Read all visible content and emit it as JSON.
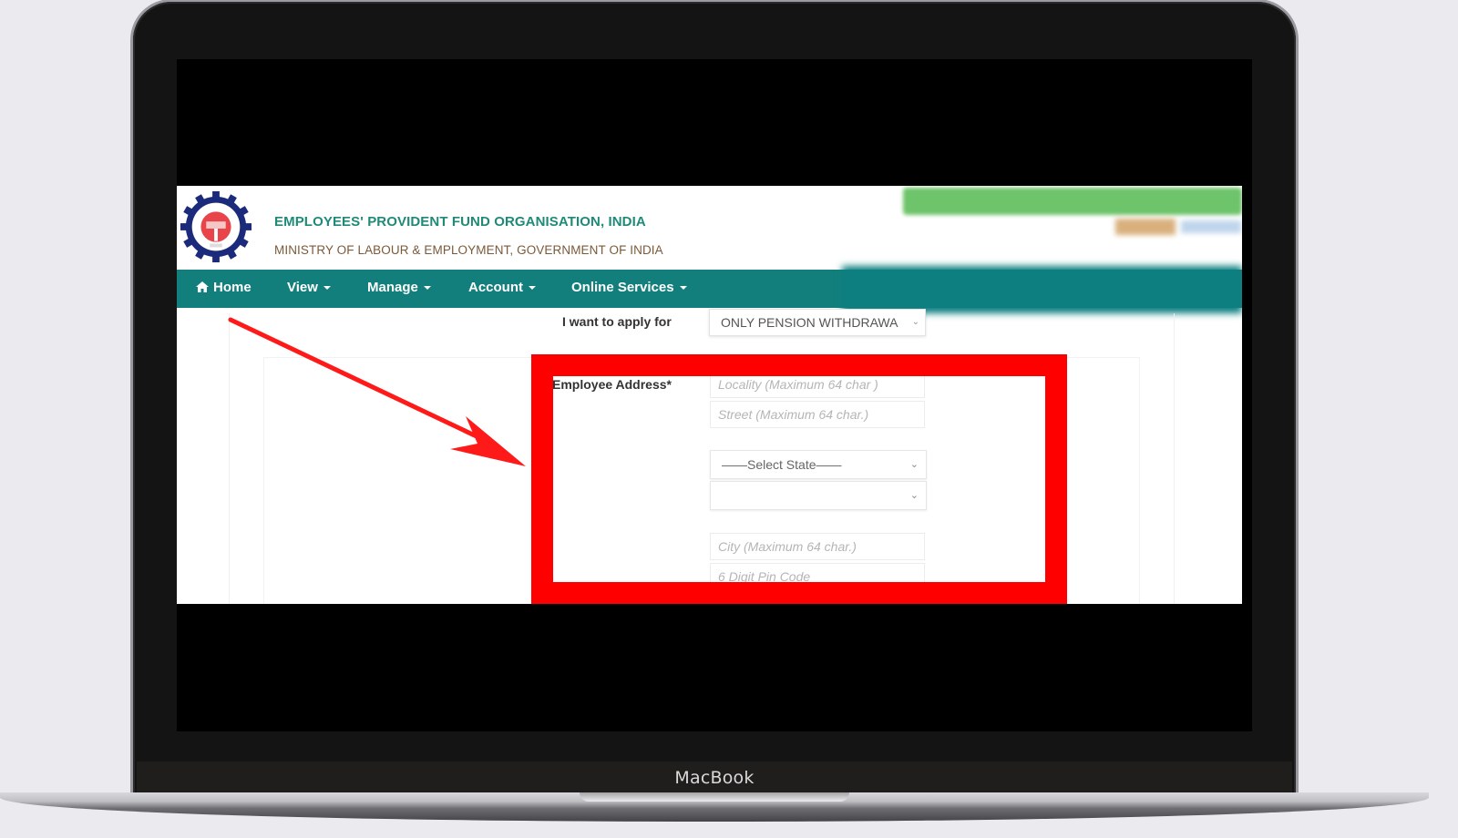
{
  "device": {
    "label": "MacBook"
  },
  "header": {
    "org_title": "EMPLOYEES' PROVIDENT FUND ORGANISATION, INDIA",
    "ministry": "MINISTRY OF LABOUR & EMPLOYMENT, GOVERNMENT OF INDIA",
    "logo_icon": "epfo-logo-icon"
  },
  "nav": {
    "items": [
      {
        "label": "Home",
        "icon": "home-icon",
        "has_dropdown": false
      },
      {
        "label": "View",
        "has_dropdown": true
      },
      {
        "label": "Manage",
        "has_dropdown": true
      },
      {
        "label": "Account",
        "has_dropdown": true
      },
      {
        "label": "Online Services",
        "has_dropdown": true
      }
    ]
  },
  "form": {
    "apply_for": {
      "label": "I want to apply for",
      "value": "ONLY PENSION WITHDRAWA"
    },
    "address": {
      "label": "Employee Address*",
      "locality_placeholder": "Locality (Maximum 64 char )",
      "street_placeholder": "Street (Maximum 64 char.)",
      "state_value": "——Select State——",
      "district_value": "",
      "city_placeholder": "City (Maximum 64 char.)",
      "pincode_placeholder": "6 Digit Pin Code"
    }
  },
  "annotation": {
    "color": "#ff0000",
    "arrow_icon": "arrow-icon",
    "highlight": "employee-address-section"
  },
  "colors": {
    "nav_bg": "#127f7c",
    "title_color": "#1f8a78",
    "ministry_color": "#7b5a3a"
  }
}
